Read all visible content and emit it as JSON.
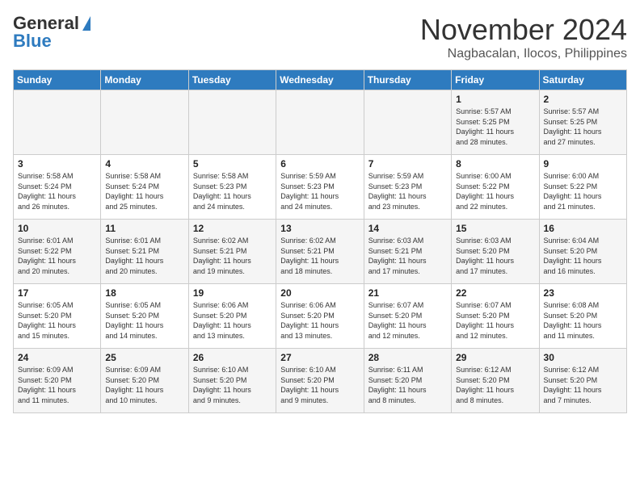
{
  "header": {
    "logo_general": "General",
    "logo_blue": "Blue",
    "month": "November 2024",
    "location": "Nagbacalan, Ilocos, Philippines"
  },
  "weekdays": [
    "Sunday",
    "Monday",
    "Tuesday",
    "Wednesday",
    "Thursday",
    "Friday",
    "Saturday"
  ],
  "weeks": [
    [
      {
        "day": "",
        "info": ""
      },
      {
        "day": "",
        "info": ""
      },
      {
        "day": "",
        "info": ""
      },
      {
        "day": "",
        "info": ""
      },
      {
        "day": "",
        "info": ""
      },
      {
        "day": "1",
        "info": "Sunrise: 5:57 AM\nSunset: 5:25 PM\nDaylight: 11 hours\nand 28 minutes."
      },
      {
        "day": "2",
        "info": "Sunrise: 5:57 AM\nSunset: 5:25 PM\nDaylight: 11 hours\nand 27 minutes."
      }
    ],
    [
      {
        "day": "3",
        "info": "Sunrise: 5:58 AM\nSunset: 5:24 PM\nDaylight: 11 hours\nand 26 minutes."
      },
      {
        "day": "4",
        "info": "Sunrise: 5:58 AM\nSunset: 5:24 PM\nDaylight: 11 hours\nand 25 minutes."
      },
      {
        "day": "5",
        "info": "Sunrise: 5:58 AM\nSunset: 5:23 PM\nDaylight: 11 hours\nand 24 minutes."
      },
      {
        "day": "6",
        "info": "Sunrise: 5:59 AM\nSunset: 5:23 PM\nDaylight: 11 hours\nand 24 minutes."
      },
      {
        "day": "7",
        "info": "Sunrise: 5:59 AM\nSunset: 5:23 PM\nDaylight: 11 hours\nand 23 minutes."
      },
      {
        "day": "8",
        "info": "Sunrise: 6:00 AM\nSunset: 5:22 PM\nDaylight: 11 hours\nand 22 minutes."
      },
      {
        "day": "9",
        "info": "Sunrise: 6:00 AM\nSunset: 5:22 PM\nDaylight: 11 hours\nand 21 minutes."
      }
    ],
    [
      {
        "day": "10",
        "info": "Sunrise: 6:01 AM\nSunset: 5:22 PM\nDaylight: 11 hours\nand 20 minutes."
      },
      {
        "day": "11",
        "info": "Sunrise: 6:01 AM\nSunset: 5:21 PM\nDaylight: 11 hours\nand 20 minutes."
      },
      {
        "day": "12",
        "info": "Sunrise: 6:02 AM\nSunset: 5:21 PM\nDaylight: 11 hours\nand 19 minutes."
      },
      {
        "day": "13",
        "info": "Sunrise: 6:02 AM\nSunset: 5:21 PM\nDaylight: 11 hours\nand 18 minutes."
      },
      {
        "day": "14",
        "info": "Sunrise: 6:03 AM\nSunset: 5:21 PM\nDaylight: 11 hours\nand 17 minutes."
      },
      {
        "day": "15",
        "info": "Sunrise: 6:03 AM\nSunset: 5:20 PM\nDaylight: 11 hours\nand 17 minutes."
      },
      {
        "day": "16",
        "info": "Sunrise: 6:04 AM\nSunset: 5:20 PM\nDaylight: 11 hours\nand 16 minutes."
      }
    ],
    [
      {
        "day": "17",
        "info": "Sunrise: 6:05 AM\nSunset: 5:20 PM\nDaylight: 11 hours\nand 15 minutes."
      },
      {
        "day": "18",
        "info": "Sunrise: 6:05 AM\nSunset: 5:20 PM\nDaylight: 11 hours\nand 14 minutes."
      },
      {
        "day": "19",
        "info": "Sunrise: 6:06 AM\nSunset: 5:20 PM\nDaylight: 11 hours\nand 13 minutes."
      },
      {
        "day": "20",
        "info": "Sunrise: 6:06 AM\nSunset: 5:20 PM\nDaylight: 11 hours\nand 13 minutes."
      },
      {
        "day": "21",
        "info": "Sunrise: 6:07 AM\nSunset: 5:20 PM\nDaylight: 11 hours\nand 12 minutes."
      },
      {
        "day": "22",
        "info": "Sunrise: 6:07 AM\nSunset: 5:20 PM\nDaylight: 11 hours\nand 12 minutes."
      },
      {
        "day": "23",
        "info": "Sunrise: 6:08 AM\nSunset: 5:20 PM\nDaylight: 11 hours\nand 11 minutes."
      }
    ],
    [
      {
        "day": "24",
        "info": "Sunrise: 6:09 AM\nSunset: 5:20 PM\nDaylight: 11 hours\nand 11 minutes."
      },
      {
        "day": "25",
        "info": "Sunrise: 6:09 AM\nSunset: 5:20 PM\nDaylight: 11 hours\nand 10 minutes."
      },
      {
        "day": "26",
        "info": "Sunrise: 6:10 AM\nSunset: 5:20 PM\nDaylight: 11 hours\nand 9 minutes."
      },
      {
        "day": "27",
        "info": "Sunrise: 6:10 AM\nSunset: 5:20 PM\nDaylight: 11 hours\nand 9 minutes."
      },
      {
        "day": "28",
        "info": "Sunrise: 6:11 AM\nSunset: 5:20 PM\nDaylight: 11 hours\nand 8 minutes."
      },
      {
        "day": "29",
        "info": "Sunrise: 6:12 AM\nSunset: 5:20 PM\nDaylight: 11 hours\nand 8 minutes."
      },
      {
        "day": "30",
        "info": "Sunrise: 6:12 AM\nSunset: 5:20 PM\nDaylight: 11 hours\nand 7 minutes."
      }
    ]
  ]
}
